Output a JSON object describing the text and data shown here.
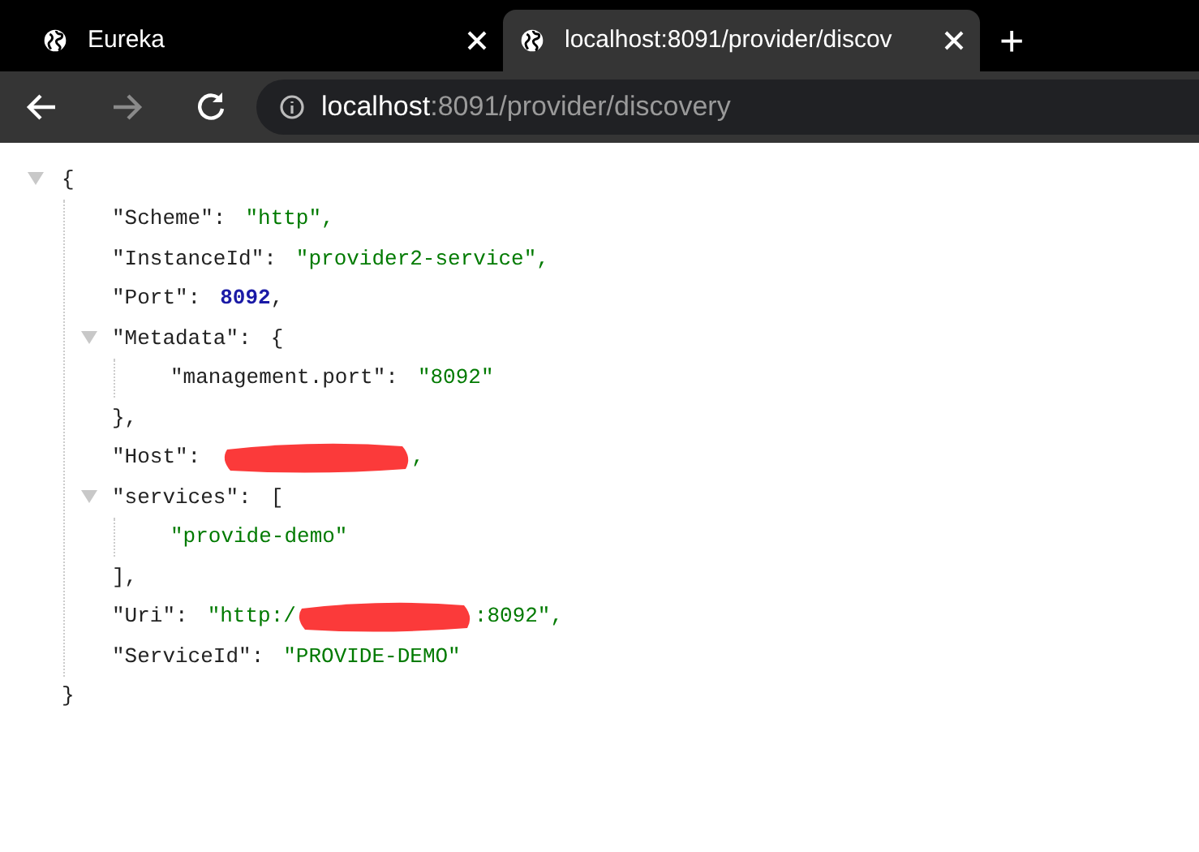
{
  "tabs": [
    {
      "title": "Eureka",
      "selected": false
    },
    {
      "title": "localhost:8091/provider/discov",
      "selected": true
    }
  ],
  "new_tab": "+",
  "address_bar": {
    "host": "localhost",
    "path": ":8091/provider/discovery"
  },
  "json_view": {
    "expanded": true,
    "open": "{",
    "close": "}",
    "children": [
      {
        "key": "\"Scheme\":",
        "kind": "string",
        "value": "\"http\","
      },
      {
        "key": "\"InstanceId\":",
        "kind": "string",
        "value": "\"provider2-service\","
      },
      {
        "key": "\"Port\":",
        "kind": "number",
        "value": "8092",
        "suffix": ","
      },
      {
        "key": "\"Metadata\":",
        "kind": "object",
        "open": "{",
        "close": "},",
        "expanded": true,
        "children": [
          {
            "key": "\"management.port\":",
            "kind": "string",
            "value": "\"8092\""
          }
        ]
      },
      {
        "key": "\"Host\":",
        "kind": "redacted",
        "suffix": ","
      },
      {
        "key": "\"services\":",
        "kind": "object",
        "open": "[",
        "close": "],",
        "expanded": true,
        "children": [
          {
            "kind": "string",
            "value": "\"provide-demo\""
          }
        ]
      },
      {
        "key": "\"Uri\":",
        "kind": "redacted",
        "prefix": "\"http:/",
        "suffix": ":8092\","
      },
      {
        "key": "\"ServiceId\":",
        "kind": "string",
        "value": "\"PROVIDE-DEMO\""
      }
    ]
  }
}
